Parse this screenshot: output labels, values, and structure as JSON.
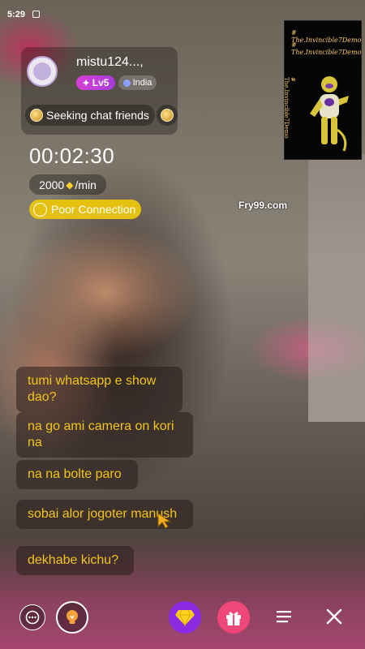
{
  "status_bar": {
    "time": "5:29"
  },
  "host": {
    "name": "mistu124...,",
    "level": "Lv5",
    "country": "India",
    "tag": "Seeking chat friends"
  },
  "call": {
    "timer": "00:02:30",
    "rate_amount": "2000",
    "rate_unit": "/min",
    "connection_status": "Poor Connection"
  },
  "overlay": {
    "thumb_line1": "# The.Invincible7Demo",
    "thumb_line2": "# The.Invincible7Demo",
    "thumb_side": "# The.Invincible7Demo",
    "watermark": "Fry99.com"
  },
  "comments": [
    "tumi whatsapp e show dao?",
    "na go ami camera on kori na",
    "na na bolte paro",
    "sobai alor jogoter manush",
    "dekhabe kichu?"
  ],
  "bottom_bar": {
    "icons": [
      "chat-icon",
      "lightbulb-icon",
      "diamond-icon",
      "gift-icon",
      "menu-icon",
      "close-icon"
    ]
  },
  "colors": {
    "level_badge": "#d63fd6",
    "connection_pill": "#e4c010",
    "comment_text": "#f2c51a",
    "gem_button": "#8a2be2",
    "gift_button": "#f0477a"
  }
}
